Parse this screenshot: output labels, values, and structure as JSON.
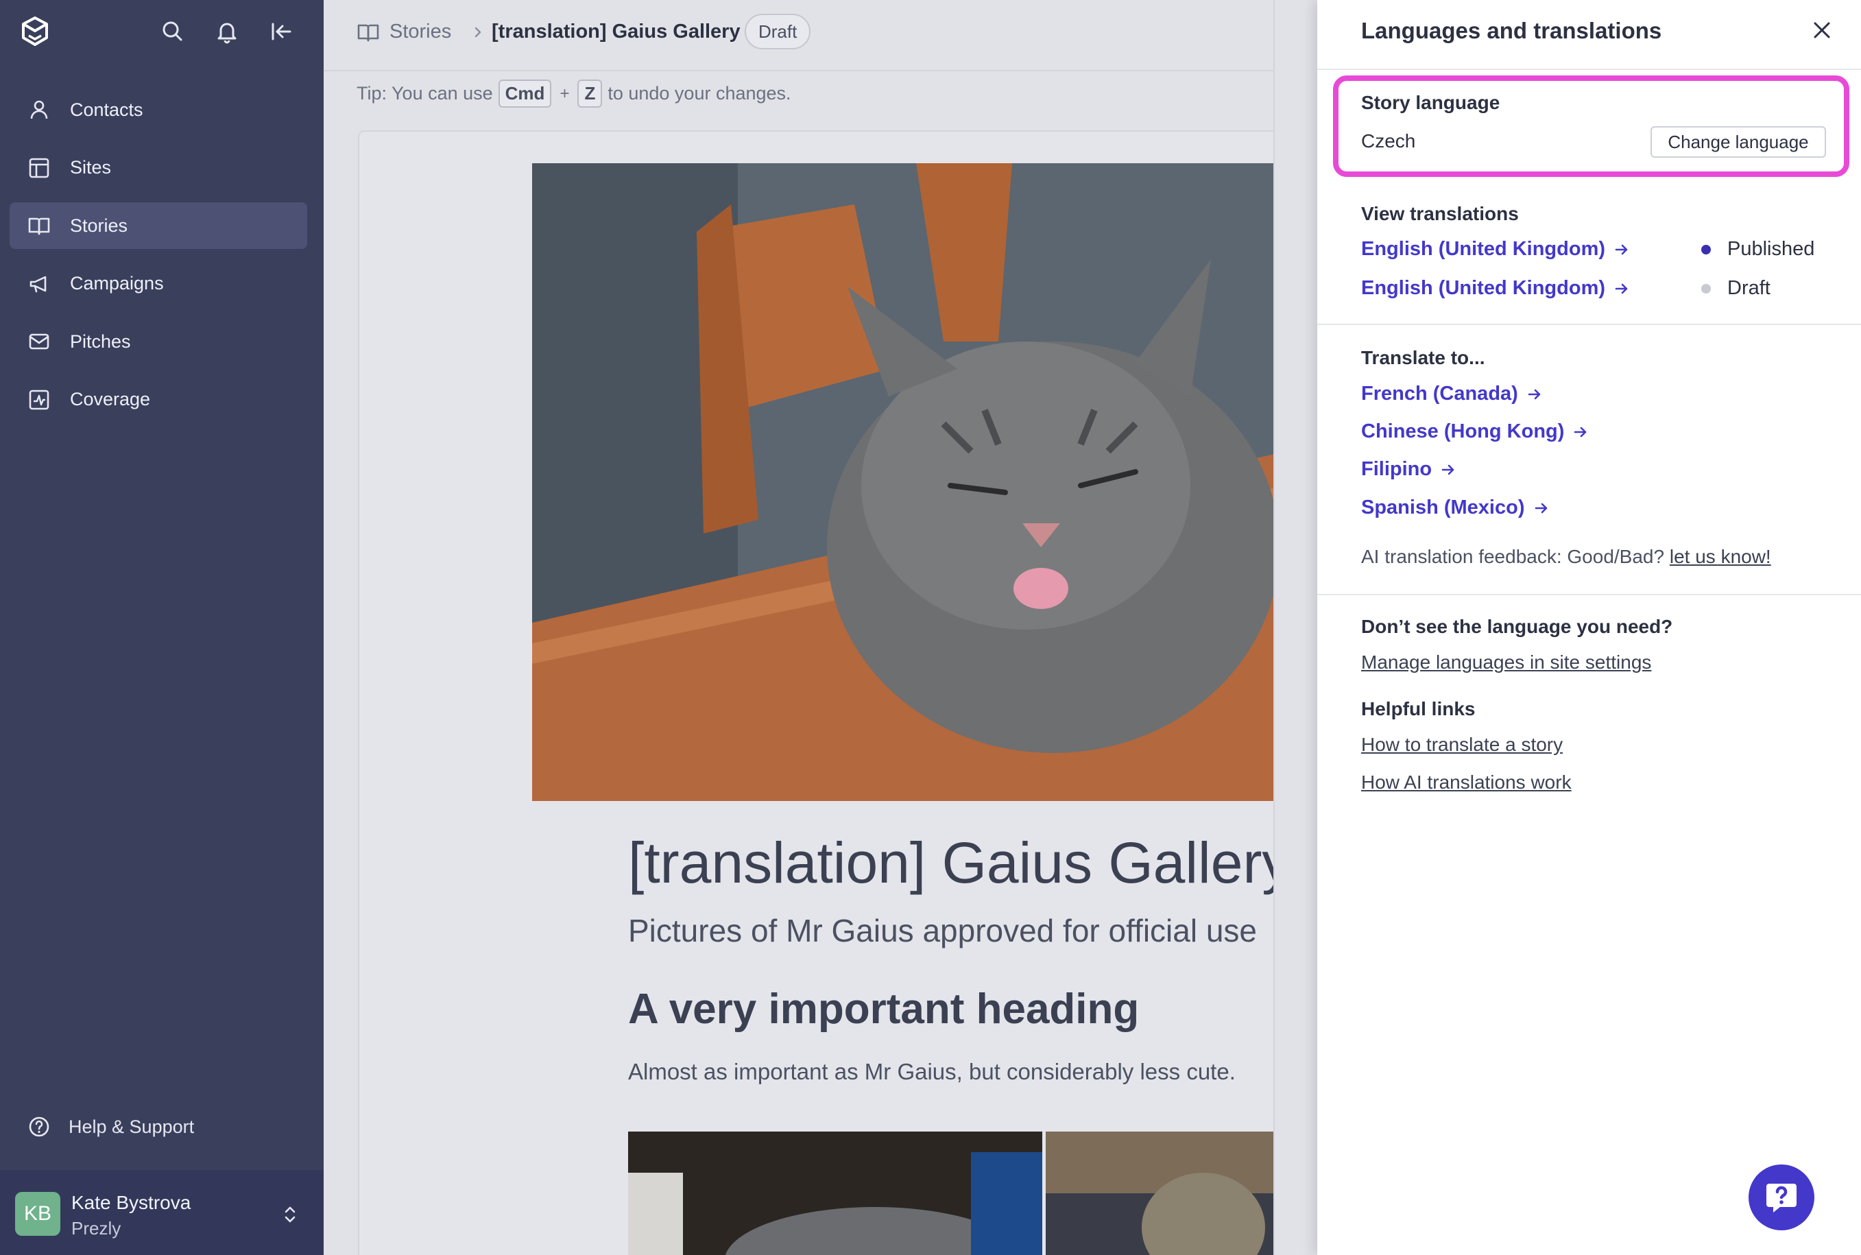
{
  "sidebar": {
    "items": [
      {
        "label": "Contacts",
        "icon": "user-icon"
      },
      {
        "label": "Sites",
        "icon": "layout-icon"
      },
      {
        "label": "Stories",
        "icon": "book-icon",
        "active": true
      },
      {
        "label": "Campaigns",
        "icon": "megaphone-icon"
      },
      {
        "label": "Pitches",
        "icon": "mail-icon"
      },
      {
        "label": "Coverage",
        "icon": "chart-icon"
      }
    ],
    "help_label": "Help & Support",
    "user": {
      "initials": "KB",
      "name": "Kate Bystrova",
      "org": "Prezly"
    }
  },
  "header": {
    "breadcrumb_root": "Stories",
    "breadcrumb_current": "[translation] Gaius Gallery",
    "status_badge": "Draft"
  },
  "tip": {
    "prefix": "Tip: You can use",
    "key1": "Cmd",
    "plus": "+",
    "key2": "Z",
    "suffix": "to undo your changes."
  },
  "story": {
    "title": "[translation] Gaius Gallery",
    "subtitle": "Pictures of Mr Gaius approved for official use",
    "heading": "A very important heading",
    "paragraph": "Almost as important as Mr Gaius, but considerably less cute."
  },
  "panel": {
    "title": "Languages and translations",
    "story_language": {
      "label": "Story language",
      "value": "Czech",
      "button": "Change language"
    },
    "view_translations": {
      "label": "View translations",
      "items": [
        {
          "language": "English (United Kingdom)",
          "status": "Published",
          "status_color": "#3b2fb0"
        },
        {
          "language": "English (United Kingdom)",
          "status": "Draft",
          "status_color": "#c8cad2"
        }
      ]
    },
    "translate_to": {
      "label": "Translate to...",
      "items": [
        "French (Canada)",
        "Chinese (Hong Kong)",
        "Filipino",
        "Spanish (Mexico)"
      ]
    },
    "feedback": {
      "text": "AI translation feedback: Good/Bad?",
      "link": "let us know!"
    },
    "missing_language": {
      "label": "Don’t see the language you need?",
      "link": "Manage languages in site settings"
    },
    "helpful_links": {
      "label": "Helpful links",
      "items": [
        "How to translate a story",
        "How AI translations work"
      ]
    }
  },
  "colors": {
    "sidebar": "#3a3f5c",
    "accent": "#4338ca",
    "highlight": "#e84ad8"
  }
}
